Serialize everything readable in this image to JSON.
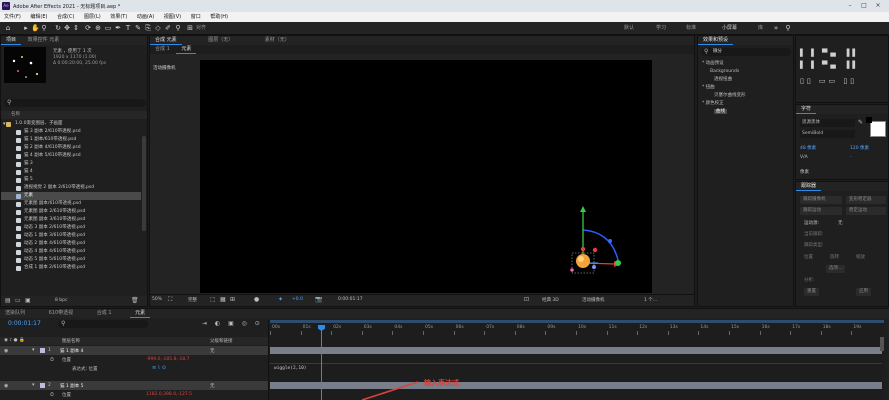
{
  "window": {
    "title": "Adobe After Effects 2021 - 无标题项目.aep *",
    "app_badge": "Ae"
  },
  "menu": [
    "文件(F)",
    "编辑(E)",
    "合成(C)",
    "图层(L)",
    "效果(T)",
    "动画(A)",
    "视图(V)",
    "窗口",
    "帮助(H)"
  ],
  "toolbar": {
    "align_label": "对齐",
    "workspaces": [
      "默认",
      "学习",
      "标准",
      "小屏幕",
      "库"
    ]
  },
  "project": {
    "tabs": [
      "项目",
      "效果控件 元素"
    ],
    "preview_name": "元素 ，使用了 1 次",
    "preview_info": [
      "1920 x 1170 (1.00)",
      "Δ 0:00:20:00, 25.00 fps"
    ],
    "search_placeholder": "",
    "col_name": "名称",
    "folder": "1.0.0渐变图层、子画面",
    "items": [
      "猫 3 副本 2/610带透视.psd",
      "猫 1 副本/610带透视.psd",
      "猫 2 副本 4/610带透视.psd",
      "猫 4 副本 5/610带透视.psd",
      "猫 3",
      "猫 4",
      "猫 5",
      "透视视觉 2 副本 2/610带透视.psd",
      "元素",
      "元素图 副本/610带透视.psd",
      "元素图 副本 2/610带透视.psd",
      "元素图 副本 3/610带透视.psd",
      "动态 3 副本 2/610带透视.psd",
      "动态 1 副本 3/610带透视.psd",
      "动态 2 副本 4/610带透视.psd",
      "动态 4 副本 4/610带透视.psd",
      "动态 5 副本 5/610带透视.psd",
      "合成 1 副本 2/610带透视.psd"
    ],
    "selected_index": 8,
    "footer_bpc": "8 bpc"
  },
  "comp": {
    "tabs": [
      "合成 元素",
      "图层（无）",
      "素材（无）"
    ],
    "sub_tabs": [
      "合成 1",
      "元素"
    ],
    "camera_label": "活动摄像机",
    "footer": {
      "zoom": "50%",
      "res": "完整",
      "timecode": "0:00:01:17",
      "quality": "经典 3D",
      "camera": "活动摄像机",
      "views": "1 个..."
    }
  },
  "effects": {
    "tab": "效果和预设",
    "search_value": "微分",
    "tree": [
      "* 动画预设",
      "Backgrounds",
      "透视扭曲",
      "* 扭曲",
      "贝塞尔曲线变形",
      "* 颜色校正",
      "曲线"
    ]
  },
  "character": {
    "tab": "字符",
    "font": "思源黑体",
    "style": "SemiBold",
    "size_label": "48 像素",
    "leading_label": "120 像素",
    "tracking_label": "像素",
    "tracking_value": "-"
  },
  "tracker": {
    "tab": "跟踪器",
    "buttons": [
      "跟踪摄像机",
      "变形稳定器",
      "跟踪运动",
      "稳定运动"
    ],
    "motion_source_label": "运动源:",
    "motion_source_value": "无",
    "current_track": "当前跟踪:",
    "track_type": "跟踪类型:",
    "checks": [
      "位置",
      "旋转",
      "缩放"
    ],
    "options": [
      "选项...",
      "分析:",
      "重置",
      "应用"
    ]
  },
  "timeline": {
    "tabs": [
      "渲染队列",
      "610带透视",
      "合成 1",
      "元素"
    ],
    "timecode": "0:00:01:17",
    "headers": {
      "layer_name": "图层名称",
      "parent": "父级和链接"
    },
    "ruler": [
      "00s",
      "01s",
      "02s",
      "03s",
      "04s",
      "05s",
      "06s",
      "07s",
      "08s",
      "09s",
      "10s",
      "11s",
      "12s",
      "13s",
      "14s",
      "15s",
      "16s",
      "17s",
      "18s",
      "19s"
    ],
    "layers": [
      {
        "num": "1",
        "name": "猫 1 副本 4",
        "prop": "位置",
        "value": "-999.0,-185.8,-18.7",
        "parent": "无"
      },
      {
        "num": "2",
        "name": "猫 1 副本 5",
        "prop": "位置",
        "value": "1182.0,398.0,-127.5",
        "parent": "无"
      }
    ],
    "expr_label": "表达式: 位置",
    "expression": "wiggle(2,10)",
    "annotation": "输入表达式",
    "bottom_labels": [
      "帧渲染时间",
      "切换开关/模式"
    ],
    "render_time": "0毫秒"
  },
  "colors": {
    "accent_blue": "#2d8ceb",
    "timecode_blue": "#4aa3ff",
    "annotation_red": "#d9433f",
    "value_orange": "#f0a050"
  }
}
